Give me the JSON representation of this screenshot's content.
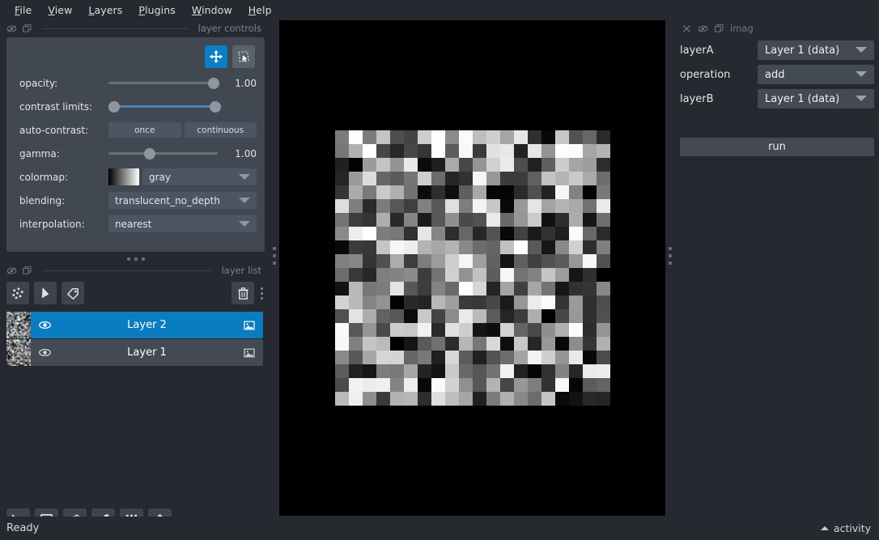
{
  "app": {
    "background": "#262930",
    "panel_bg": "#414851",
    "accent": "#0a80c4",
    "status_text": "Ready",
    "activity_label": "activity"
  },
  "menubar": {
    "items": [
      {
        "label": "File",
        "mnemonic": "F"
      },
      {
        "label": "View",
        "mnemonic": "V"
      },
      {
        "label": "Layers",
        "mnemonic": "L"
      },
      {
        "label": "Plugins",
        "mnemonic": "P"
      },
      {
        "label": "Window",
        "mnemonic": "W"
      },
      {
        "label": "Help",
        "mnemonic": "H"
      }
    ]
  },
  "layer_controls": {
    "dock_title": "layer controls",
    "mode_buttons": [
      {
        "name": "pan-zoom",
        "active": true
      },
      {
        "name": "transform",
        "active": false
      }
    ],
    "rows": {
      "opacity": {
        "label": "opacity:",
        "value": "1.00",
        "handle_pct": 96
      },
      "contrast_limits": {
        "label": "contrast limits:",
        "low_pct": 0,
        "high_pct": 100
      },
      "auto_contrast": {
        "label": "auto-contrast:",
        "buttons": [
          "once",
          "continuous"
        ]
      },
      "gamma": {
        "label": "gamma:",
        "value": "1.00",
        "handle_pct": 38
      },
      "colormap": {
        "label": "colormap:",
        "value": "gray"
      },
      "blending": {
        "label": "blending:",
        "value": "translucent_no_depth"
      },
      "interpolation": {
        "label": "interpolation:",
        "value": "nearest"
      }
    }
  },
  "layer_list": {
    "dock_title": "layer list",
    "tools": [
      "new-points",
      "new-shapes",
      "new-labels",
      "delete-layer"
    ],
    "layers": [
      {
        "name": "Layer 2",
        "visible": true,
        "selected": true,
        "type": "image"
      },
      {
        "name": "Layer 1",
        "visible": true,
        "selected": false,
        "type": "image"
      }
    ]
  },
  "viewer_buttons": [
    {
      "name": "console"
    },
    {
      "name": "ndisplay-toggle"
    },
    {
      "name": "roll-dims"
    },
    {
      "name": "transpose-dims"
    },
    {
      "name": "grid-view"
    },
    {
      "name": "home-reset"
    }
  ],
  "plugin_widget": {
    "dock_title": "imag",
    "fields": [
      {
        "label": "layerA",
        "value": "Layer 1 (data)"
      },
      {
        "label": "operation",
        "value": "add"
      },
      {
        "label": "layerB",
        "value": "Layer 1 (data)"
      }
    ],
    "run_label": "run"
  },
  "canvas": {
    "background": "#000000",
    "image": {
      "rows": 20,
      "cols": 20,
      "colormap": "gray",
      "description": "random grayscale noise"
    }
  }
}
